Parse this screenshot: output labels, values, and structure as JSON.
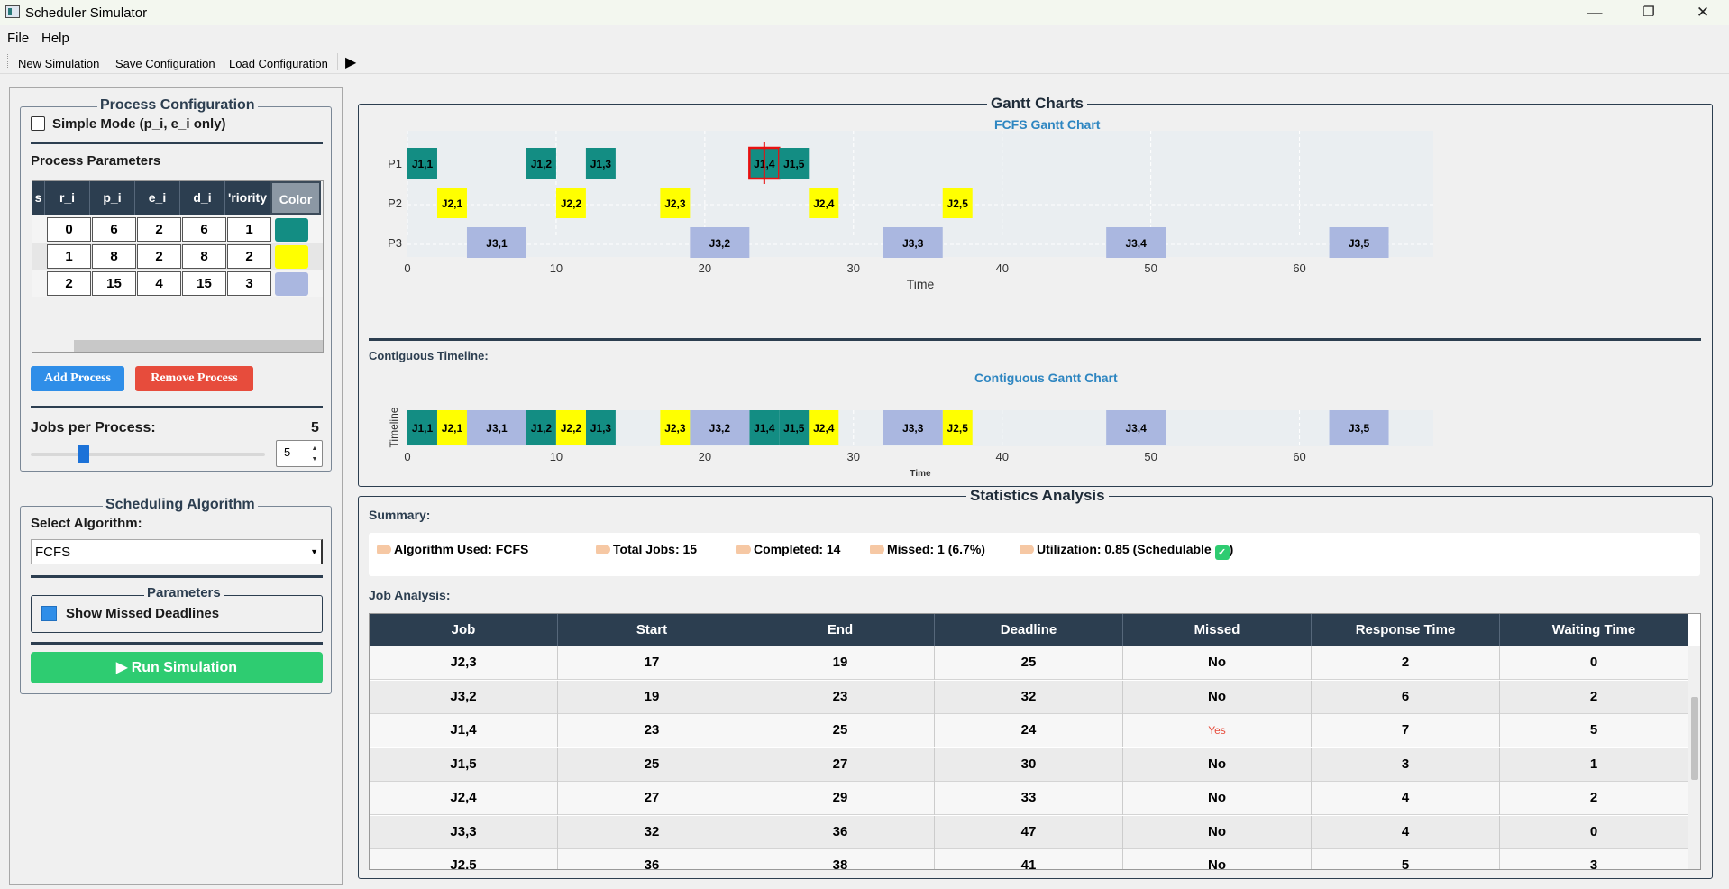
{
  "window": {
    "title": "Scheduler Simulator",
    "min": "—",
    "restore": "❐",
    "close": "✕"
  },
  "menu": [
    "File",
    "Help"
  ],
  "toolbar": {
    "items": [
      "New Simulation",
      "Save Configuration",
      "Load Configuration"
    ],
    "play": "▶"
  },
  "process_config": {
    "title": "Process Configuration",
    "simple_mode": "Simple Mode (p_i, e_i only)",
    "params_label": "Process Parameters",
    "headers": [
      "s",
      "r_i",
      "p_i",
      "e_i",
      "d_i",
      "'riority",
      "Color"
    ],
    "rows": [
      {
        "r": "0",
        "p": "6",
        "e": "2",
        "d": "6",
        "prio": "1",
        "color": "#138d83"
      },
      {
        "r": "1",
        "p": "8",
        "e": "2",
        "d": "8",
        "prio": "2",
        "color": "#ffff00"
      },
      {
        "r": "2",
        "p": "15",
        "e": "4",
        "d": "15",
        "prio": "3",
        "color": "#aab7e0"
      }
    ],
    "add_button": "Add Process",
    "remove_button": "Remove Process",
    "jobs_label": "Jobs per Process:",
    "jobs_value": "5",
    "jobs_slider_fraction": 0.2,
    "spin_value": "5"
  },
  "scheduling": {
    "title": "Scheduling Algorithm",
    "select_label": "Select Algorithm:",
    "algorithm": "FCFS",
    "params_title": "Parameters",
    "show_missed": "Show Missed Deadlines",
    "run_button": "▶ Run Simulation"
  },
  "gantt": {
    "frame_title": "Gantt Charts",
    "chart_title": "FCFS Gantt Chart",
    "contig_label": "Contiguous Timeline:",
    "contig_title": "Contiguous Gantt Chart",
    "xlabel": "Time",
    "contig_ylabel": "Timeline"
  },
  "chart_data": [
    {
      "type": "gantt",
      "title": "FCFS Gantt Chart",
      "xlabel": "Time",
      "xlim": [
        0,
        69
      ],
      "xticks": [
        0,
        10,
        20,
        30,
        40,
        50,
        60
      ],
      "rows": [
        "P1",
        "P2",
        "P3"
      ],
      "colors": {
        "P1": "#138d83",
        "P2": "#ffff00",
        "P3": "#aab7e0"
      },
      "jobs": [
        {
          "label": "J1,1",
          "row": "P1",
          "start": 0,
          "end": 2
        },
        {
          "label": "J1,2",
          "row": "P1",
          "start": 8,
          "end": 10
        },
        {
          "label": "J1,3",
          "row": "P1",
          "start": 12,
          "end": 14
        },
        {
          "label": "J1,4",
          "row": "P1",
          "start": 23,
          "end": 25,
          "missed": true,
          "deadline": 24
        },
        {
          "label": "J1,5",
          "row": "P1",
          "start": 25,
          "end": 27
        },
        {
          "label": "J2,1",
          "row": "P2",
          "start": 2,
          "end": 4
        },
        {
          "label": "J2,2",
          "row": "P2",
          "start": 10,
          "end": 12
        },
        {
          "label": "J2,3",
          "row": "P2",
          "start": 17,
          "end": 19
        },
        {
          "label": "J2,4",
          "row": "P2",
          "start": 27,
          "end": 29
        },
        {
          "label": "J2,5",
          "row": "P2",
          "start": 36,
          "end": 38
        },
        {
          "label": "J3,1",
          "row": "P3",
          "start": 4,
          "end": 8
        },
        {
          "label": "J3,2",
          "row": "P3",
          "start": 19,
          "end": 23
        },
        {
          "label": "J3,3",
          "row": "P3",
          "start": 32,
          "end": 36
        },
        {
          "label": "J3,4",
          "row": "P3",
          "start": 47,
          "end": 51
        },
        {
          "label": "J3,5",
          "row": "P3",
          "start": 62,
          "end": 66
        }
      ]
    },
    {
      "type": "gantt",
      "title": "Contiguous Gantt Chart",
      "xlabel": "Time",
      "ylabel": "Timeline",
      "xlim": [
        0,
        69
      ],
      "xticks": [
        0,
        10,
        20,
        30,
        40,
        50,
        60
      ],
      "rows": [
        "Timeline"
      ]
    }
  ],
  "stats": {
    "frame_title": "Statistics  Analysis",
    "summary_label": "Summary:",
    "summary": {
      "algorithm": "Algorithm Used: FCFS",
      "total": "Total Jobs: 15",
      "completed": "Completed: 14",
      "missed": "Missed: 1 (6.7%)",
      "utilization": "Utilization: 0.85 (Schedulable",
      "util_close": ")",
      "check": "✓"
    },
    "job_analysis_label": "Job Analysis:",
    "headers": [
      "Job",
      "Start",
      "End",
      "Deadline",
      "Missed",
      "Response Time",
      "Waiting Time"
    ],
    "rows": [
      [
        "J2,3",
        "17",
        "19",
        "25",
        "No",
        "2",
        "0"
      ],
      [
        "J3,2",
        "19",
        "23",
        "32",
        "No",
        "6",
        "2"
      ],
      [
        "J1,4",
        "23",
        "25",
        "24",
        "Yes",
        "7",
        "5"
      ],
      [
        "J1,5",
        "25",
        "27",
        "30",
        "No",
        "3",
        "1"
      ],
      [
        "J2,4",
        "27",
        "29",
        "33",
        "No",
        "4",
        "2"
      ],
      [
        "J3,3",
        "32",
        "36",
        "47",
        "No",
        "4",
        "0"
      ],
      [
        "J2,5",
        "36",
        "38",
        "41",
        "No",
        "5",
        "3"
      ]
    ]
  }
}
